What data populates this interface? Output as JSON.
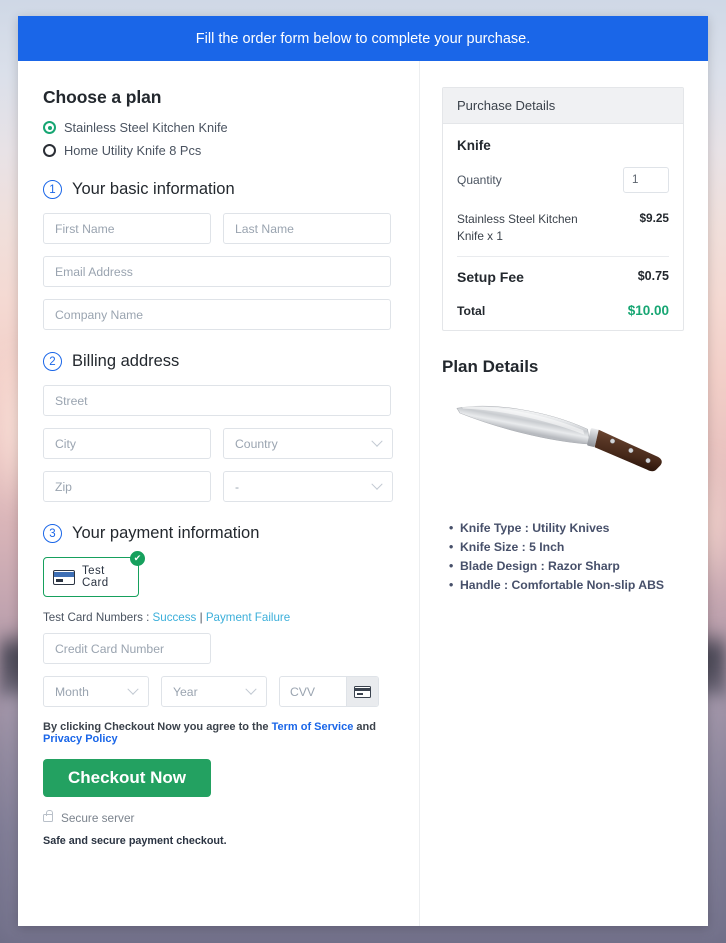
{
  "banner": {
    "text": "Fill the order form below to complete your purchase."
  },
  "plan": {
    "heading": "Choose a plan",
    "options": [
      {
        "label": "Stainless Steel Kitchen Knife",
        "selected": true
      },
      {
        "label": "Home Utility Knife 8 Pcs",
        "selected": false
      }
    ]
  },
  "steps": {
    "one": {
      "num": "1",
      "label": "Your basic information"
    },
    "two": {
      "num": "2",
      "label": "Billing address"
    },
    "three": {
      "num": "3",
      "label": "Your payment information"
    }
  },
  "basic_info": {
    "first_name": "First Name",
    "last_name": "Last Name",
    "email": "Email Address",
    "company": "Company Name"
  },
  "billing": {
    "street": "Street",
    "city": "City",
    "country": "Country",
    "zip": "Zip",
    "state": "-"
  },
  "payment": {
    "method_label": "Test Card",
    "method_selected": true,
    "check_glyph": "✔",
    "test_numbers_prefix": "Test Card Numbers : ",
    "link_success": "Success",
    "separator": " | ",
    "link_failure": "Payment Failure",
    "card_number": "Credit Card Number",
    "month": "Month",
    "year": "Year",
    "cvv": "CVV"
  },
  "terms": {
    "prefix": "By clicking Checkout Now you agree to the ",
    "tos": "Term of Service",
    "middle": " and ",
    "privacy": "Privacy Policy"
  },
  "checkout": {
    "button_label": "Checkout Now",
    "secure_server": "Secure server",
    "safe_note": "Safe and secure payment checkout."
  },
  "purchase": {
    "header": "Purchase Details",
    "product": "Knife",
    "quantity_label": "Quantity",
    "quantity_value": "1",
    "line_item": {
      "name": "Stainless Steel Kitchen Knife x 1",
      "amount": "$9.25"
    },
    "setup_fee": {
      "name": "Setup Fee",
      "amount": "$0.75"
    },
    "total": {
      "name": "Total",
      "amount": "$10.00"
    }
  },
  "plan_details": {
    "heading": "Plan Details",
    "image_alt": "kitchen-knife-image",
    "bullets": [
      "Knife Type : Utility Knives",
      "Knife Size : 5 Inch",
      "Blade Design : Razor Sharp",
      "Handle : Comfortable Non-slip ABS"
    ]
  },
  "colors": {
    "banner_blue": "#1a66e8",
    "accent_green": "#23a161",
    "total_green": "#17a673",
    "link_teal": "#3bafda",
    "link_blue": "#1a66e8"
  }
}
